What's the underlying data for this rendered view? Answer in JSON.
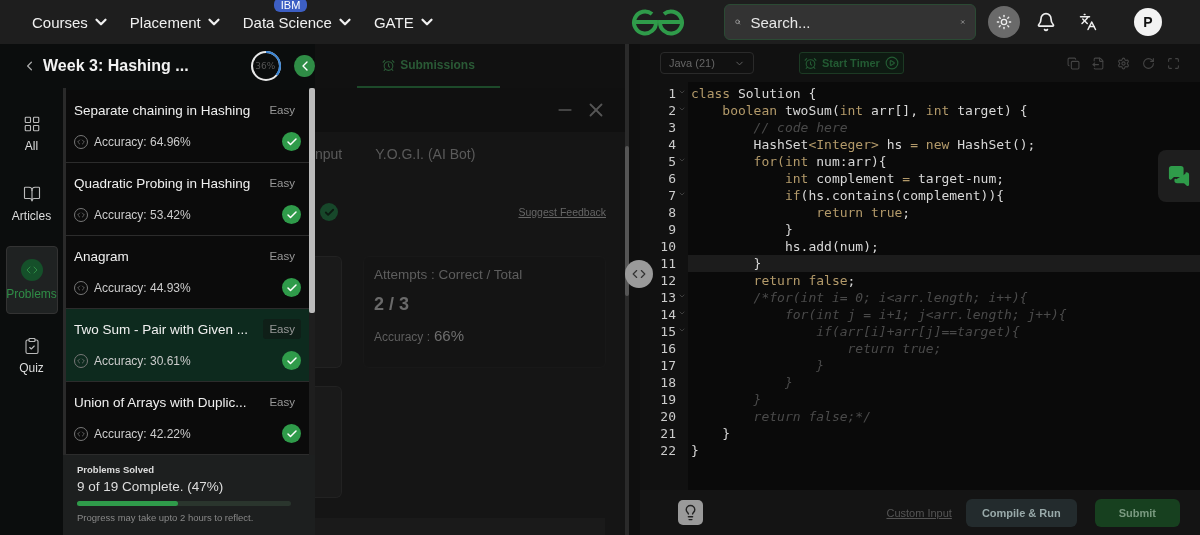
{
  "nav": {
    "menus": [
      {
        "label": "Courses"
      },
      {
        "label": "Placement"
      },
      {
        "label": "Data Science",
        "badge": "IBM"
      },
      {
        "label": "GATE"
      }
    ],
    "search": {
      "placeholder": "Search..."
    },
    "avatar": "P"
  },
  "course": {
    "title": "Week 3: Hashing ...",
    "progress": {
      "label": "36%",
      "level": 0.36
    }
  },
  "side_nav": [
    {
      "label": "All",
      "kind": "all",
      "selected": false
    },
    {
      "label": "Articles",
      "kind": "articles",
      "selected": false
    },
    {
      "label": "Problems",
      "kind": "problems",
      "selected": true
    },
    {
      "label": "Quiz",
      "kind": "quiz",
      "selected": false
    }
  ],
  "problems": [
    {
      "title": "Separate chaining in Hashing",
      "difficulty": "Easy",
      "accuracy": "Accuracy: 64.96%",
      "solved": true,
      "selected": false
    },
    {
      "title": "Quadratic Probing in Hashing",
      "difficulty": "Easy",
      "accuracy": "Accuracy: 53.42%",
      "solved": true,
      "selected": false
    },
    {
      "title": "Anagram",
      "difficulty": "Easy",
      "accuracy": "Accuracy: 44.93%",
      "solved": true,
      "selected": false
    },
    {
      "title": "Two Sum - Pair with Given ...",
      "difficulty": "Easy",
      "accuracy": "Accuracy: 30.61%",
      "solved": true,
      "selected": true
    },
    {
      "title": "Union of Arrays with Duplic...",
      "difficulty": "Easy",
      "accuracy": "Accuracy: 42.22%",
      "solved": true,
      "selected": false
    }
  ],
  "solved_summary": {
    "title": "Problems Solved",
    "count": "9 of 19 Complete. (47%)",
    "level": 0.47,
    "note": "Progress may take upto 2 hours to reflect."
  },
  "middle": {
    "tab": {
      "label": "Submissions",
      "selected": true
    },
    "tabs": [
      {
        "label": "nput",
        "selected": false
      },
      {
        "label": "Y.O.G.I. (AI Bot)",
        "selected": false
      }
    ],
    "feedback_link": "Suggest Feedback",
    "attempts": {
      "title": "Attempts : Correct / Total",
      "value": "2 / 3",
      "accuracy_label": "Accuracy :",
      "accuracy": "66%"
    }
  },
  "editor": {
    "language": "Java (21)",
    "timer": "Start Timer",
    "lines": [
      {
        "number": "1",
        "foldable": true,
        "current": false,
        "tokens": [
          {
            "kind": "kw",
            "text": "class"
          },
          {
            "kind": "text",
            "text": " Solution {"
          }
        ]
      },
      {
        "number": "2",
        "foldable": true,
        "current": false,
        "tokens": [
          {
            "kind": "kw",
            "text": "    boolean"
          },
          {
            "kind": "text",
            "text": " twoSum("
          },
          {
            "kind": "kw",
            "text": "int"
          },
          {
            "kind": "text",
            "text": " arr[], "
          },
          {
            "kind": "kw",
            "text": "int"
          },
          {
            "kind": "text",
            "text": " target) {"
          }
        ]
      },
      {
        "number": "3",
        "foldable": false,
        "current": false,
        "tokens": [
          {
            "kind": "comment",
            "text": "        // code here"
          }
        ]
      },
      {
        "number": "4",
        "foldable": false,
        "current": false,
        "tokens": [
          {
            "kind": "text",
            "text": "        HashSet"
          },
          {
            "kind": "kw",
            "text": "<Integer>"
          },
          {
            "kind": "text",
            "text": " hs "
          },
          {
            "kind": "kw",
            "text": "= new"
          },
          {
            "kind": "text",
            "text": " HashSet();"
          }
        ]
      },
      {
        "number": "5",
        "foldable": true,
        "current": false,
        "tokens": [
          {
            "kind": "kw",
            "text": "        for(int"
          },
          {
            "kind": "text",
            "text": " num:arr){"
          }
        ]
      },
      {
        "number": "6",
        "foldable": false,
        "current": false,
        "tokens": [
          {
            "kind": "kw",
            "text": "            int"
          },
          {
            "kind": "text",
            "text": " complement "
          },
          {
            "kind": "kw",
            "text": "="
          },
          {
            "kind": "text",
            "text": " target-num;"
          }
        ]
      },
      {
        "number": "7",
        "foldable": true,
        "current": false,
        "tokens": [
          {
            "kind": "kw",
            "text": "            if"
          },
          {
            "kind": "text",
            "text": "(hs.contains(complement)){"
          }
        ]
      },
      {
        "number": "8",
        "foldable": false,
        "current": false,
        "tokens": [
          {
            "kind": "kw",
            "text": "                return true"
          },
          {
            "kind": "text",
            "text": ";"
          }
        ]
      },
      {
        "number": "9",
        "foldable": false,
        "current": false,
        "tokens": [
          {
            "kind": "text",
            "text": "            }"
          }
        ]
      },
      {
        "number": "10",
        "foldable": false,
        "current": false,
        "tokens": [
          {
            "kind": "text",
            "text": "            hs.add(num);"
          }
        ]
      },
      {
        "number": "11",
        "foldable": false,
        "current": true,
        "tokens": [
          {
            "kind": "text",
            "text": "        }"
          }
        ]
      },
      {
        "number": "12",
        "foldable": false,
        "current": false,
        "tokens": [
          {
            "kind": "kw",
            "text": "        return false"
          },
          {
            "kind": "text",
            "text": ";"
          }
        ]
      },
      {
        "number": "13",
        "foldable": true,
        "current": false,
        "tokens": [
          {
            "kind": "comment",
            "text": "        /*for(int i= 0; i<arr.length; i++){"
          }
        ]
      },
      {
        "number": "14",
        "foldable": true,
        "current": false,
        "tokens": [
          {
            "kind": "comment",
            "text": "            for(int j = i+1; j<arr.length; j++){"
          }
        ]
      },
      {
        "number": "15",
        "foldable": true,
        "current": false,
        "tokens": [
          {
            "kind": "comment",
            "text": "                if(arr[i]+arr[j]==target){"
          }
        ]
      },
      {
        "number": "16",
        "foldable": false,
        "current": false,
        "tokens": [
          {
            "kind": "comment",
            "text": "                    return true;"
          }
        ]
      },
      {
        "number": "17",
        "foldable": false,
        "current": false,
        "tokens": [
          {
            "kind": "comment",
            "text": "                }"
          }
        ]
      },
      {
        "number": "18",
        "foldable": false,
        "current": false,
        "tokens": [
          {
            "kind": "comment",
            "text": "            }"
          }
        ]
      },
      {
        "number": "19",
        "foldable": false,
        "current": false,
        "tokens": [
          {
            "kind": "comment",
            "text": "        }"
          }
        ]
      },
      {
        "number": "20",
        "foldable": false,
        "current": false,
        "tokens": [
          {
            "kind": "comment",
            "text": "        return false;*/"
          }
        ]
      },
      {
        "number": "21",
        "foldable": false,
        "current": false,
        "tokens": [
          {
            "kind": "text",
            "text": "    }"
          }
        ]
      },
      {
        "number": "22",
        "foldable": false,
        "current": false,
        "tokens": [
          {
            "kind": "text",
            "text": "}"
          }
        ]
      }
    ],
    "custom_input": "Custom Input",
    "buttons": [
      {
        "label": "Compile & Run",
        "kind": "secondary"
      },
      {
        "label": "Submit",
        "kind": "primary"
      }
    ]
  }
}
